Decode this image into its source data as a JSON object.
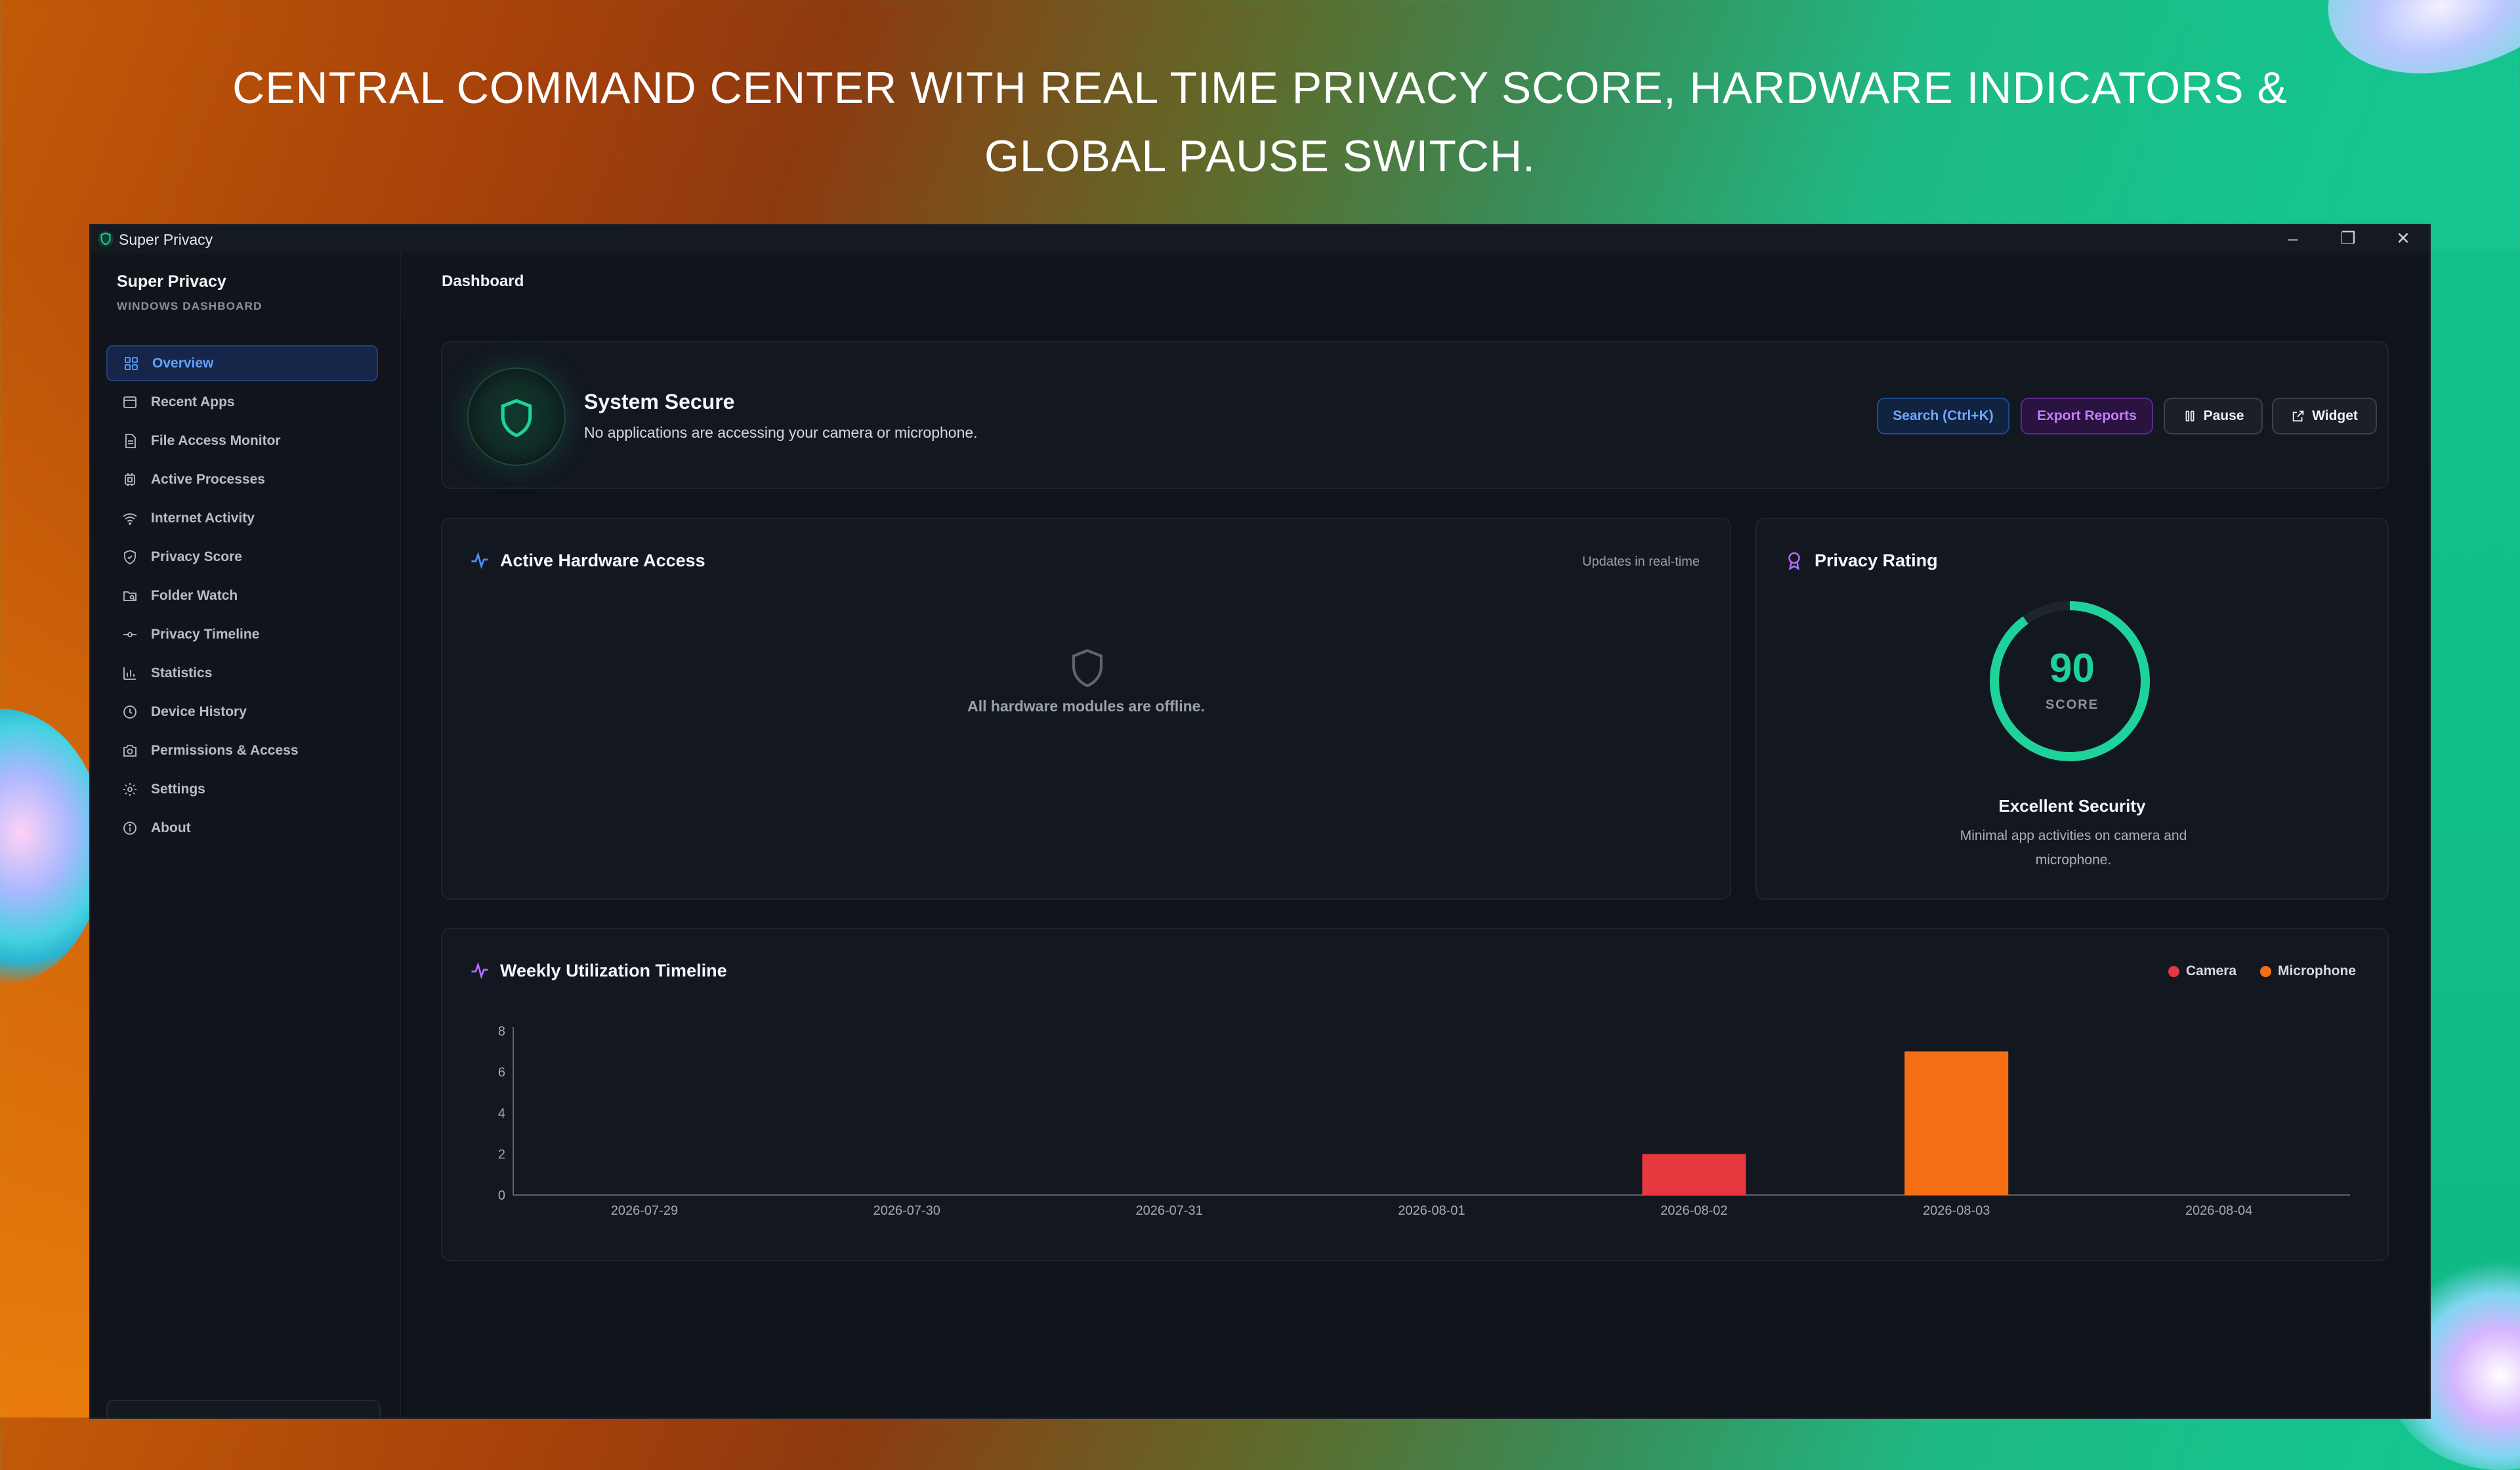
{
  "banner": {
    "line1": "CENTRAL COMMAND CENTER WITH REAL TIME PRIVACY SCORE, HARDWARE INDICATORS &",
    "line2": "GLOBAL PAUSE SWITCH."
  },
  "window": {
    "title": "Super Privacy",
    "controls": {
      "minimize": "–",
      "restore": "❐",
      "close": "✕"
    }
  },
  "sidebar": {
    "brand_title": "Super Privacy",
    "brand_subtitle": "WINDOWS DASHBOARD",
    "items": [
      {
        "label": "Overview",
        "icon": "grid-icon",
        "active": true
      },
      {
        "label": "Recent Apps",
        "icon": "window-icon"
      },
      {
        "label": "File Access Monitor",
        "icon": "file-icon"
      },
      {
        "label": "Active Processes",
        "icon": "cpu-icon"
      },
      {
        "label": "Internet Activity",
        "icon": "wifi-icon"
      },
      {
        "label": "Privacy Score",
        "icon": "shield-icon"
      },
      {
        "label": "Folder Watch",
        "icon": "folder-search-icon"
      },
      {
        "label": "Privacy Timeline",
        "icon": "commit-icon"
      },
      {
        "label": "Statistics",
        "icon": "bar-chart-icon"
      },
      {
        "label": "Device History",
        "icon": "clock-icon"
      },
      {
        "label": "Permissions & Access",
        "icon": "camera-icon"
      },
      {
        "label": "Settings",
        "icon": "gear-icon"
      },
      {
        "label": "About",
        "icon": "info-icon"
      }
    ]
  },
  "header": {
    "title": "Dashboard"
  },
  "status": {
    "title": "System Secure",
    "description": "No applications are accessing your camera or microphone.",
    "buttons": {
      "search": "Search (Ctrl+K)",
      "export": "Export Reports",
      "pause": "Pause",
      "widget": "Widget"
    }
  },
  "hardware": {
    "title": "Active Hardware Access",
    "realtime": "Updates in real-time",
    "empty": "All hardware modules are offline."
  },
  "privacy": {
    "title": "Privacy Rating",
    "score": "90",
    "score_fraction": 0.9,
    "score_label": "SCORE",
    "rating": "Excellent Security",
    "description": "Minimal app activities on camera and microphone."
  },
  "timeline": {
    "title": "Weekly Utilization Timeline",
    "legend": {
      "camera": "Camera",
      "microphone": "Microphone"
    }
  },
  "colors": {
    "accent_green": "#1ed39a",
    "camera": "#e5383f",
    "microphone": "#f46f14",
    "active_nav": "#5fa2ff"
  },
  "chart_data": {
    "type": "bar",
    "categories": [
      "2026-07-29",
      "2026-07-30",
      "2026-07-31",
      "2026-08-01",
      "2026-08-02",
      "2026-08-03",
      "2026-08-04"
    ],
    "series": [
      {
        "name": "Camera",
        "values": [
          0,
          0,
          0,
          0,
          2,
          0,
          0
        ]
      },
      {
        "name": "Microphone",
        "values": [
          0,
          0,
          0,
          0,
          0,
          7,
          0
        ]
      }
    ],
    "yticks": [
      0,
      2,
      4,
      6,
      8
    ],
    "ylim": [
      0,
      8
    ],
    "legend": "top-right",
    "grid": false
  }
}
